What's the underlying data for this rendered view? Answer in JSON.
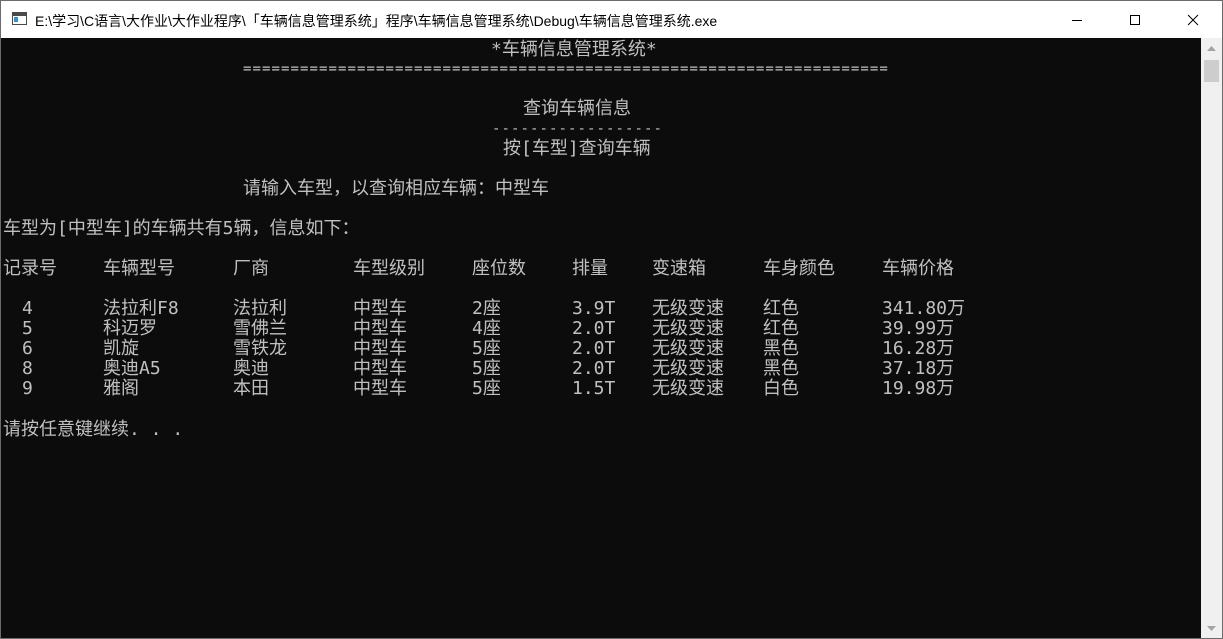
{
  "window": {
    "title": "E:\\学习\\C语言\\大作业\\大作业程序\\「车辆信息管理系统」程序\\车辆信息管理系统\\Debug\\车辆信息管理系统.exe",
    "icon": "console-app-icon",
    "controls": {
      "minimize": "minimize-icon",
      "maximize": "maximize-icon",
      "close": "close-icon"
    }
  },
  "colors": {
    "console_bg": "#0c0c0c",
    "console_text": "#c0c0c0",
    "titlebar_bg": "#ffffff",
    "scrollbar_bg": "#f0f0f0",
    "scroll_thumb": "#cdcdcd"
  },
  "console": {
    "header_title": "*车辆信息管理系统*",
    "header_rule": "====================================================================",
    "section_title": "查询车辆信息",
    "section_rule": "------------------",
    "sub_title": "按[车型]查询车辆",
    "prompt": "请输入车型，以查询相应车辆：中型车",
    "summary": "车型为[中型车]的车辆共有5辆，信息如下：",
    "table": {
      "headers": [
        "记录号",
        "车辆型号",
        "厂商",
        "车型级别",
        "座位数",
        "排量",
        "变速箱",
        "车身颜色",
        "车辆价格"
      ],
      "rows": [
        [
          "4",
          "法拉利F8",
          "法拉利",
          "中型车",
          "2座",
          "3.9T",
          "无级变速",
          "红色",
          "341.80万"
        ],
        [
          "5",
          "科迈罗",
          "雪佛兰",
          "中型车",
          "4座",
          "2.0T",
          "无级变速",
          "红色",
          "39.99万"
        ],
        [
          "6",
          "凯旋",
          "雪铁龙",
          "中型车",
          "5座",
          "2.0T",
          "无级变速",
          "黑色",
          "16.28万"
        ],
        [
          "8",
          "奥迪A5",
          "奥迪",
          "中型车",
          "5座",
          "2.0T",
          "无级变速",
          "黑色",
          "37.18万"
        ],
        [
          "9",
          "雅阁",
          "本田",
          "中型车",
          "5座",
          "1.5T",
          "无级变速",
          "白色",
          "19.98万"
        ]
      ]
    },
    "continue_prompt": "请按任意键继续. . ."
  },
  "scrollbar": {
    "up_icon": "scroll-up-arrow-icon",
    "down_icon": "scroll-down-arrow-icon"
  }
}
